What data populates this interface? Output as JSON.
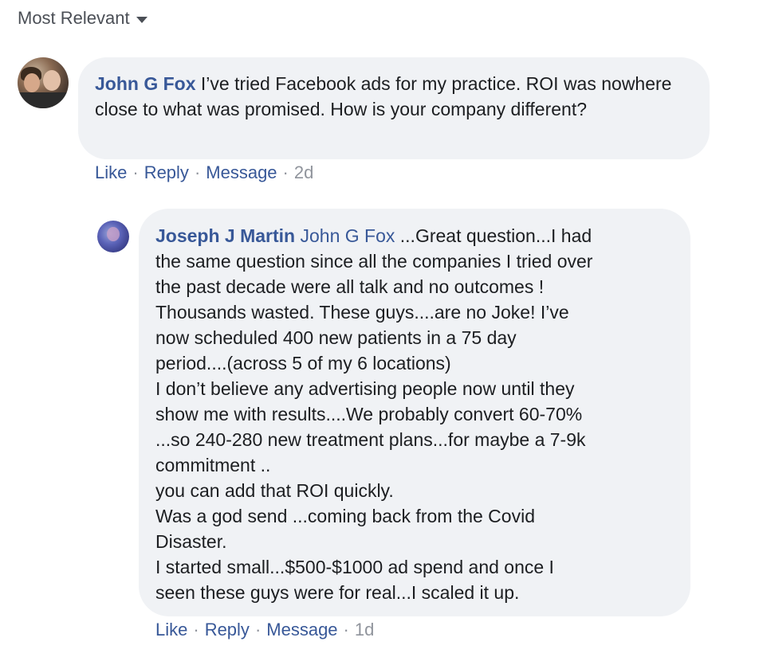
{
  "sort": {
    "label": "Most Relevant"
  },
  "comments": [
    {
      "author": "John G Fox",
      "text": "I’ve tried Facebook ads for my practice. ROI was nowhere close to what was promised. How is your company different?",
      "actions": {
        "like": "Like",
        "reply": "Reply",
        "message": "Message",
        "time": "2d"
      }
    }
  ],
  "replies": [
    {
      "author": "Joseph J Martin",
      "mention": "John G Fox",
      "lines": [
        "...Great question...I had",
        "the same question since all the companies I tried over",
        "the past decade were all talk and no outcomes !",
        "Thousands wasted. These guys....are no Joke! I’ve",
        "now scheduled 400 new patients in a 75 day",
        "period....(across 5 of my 6 locations)",
        "I don’t believe any advertising people now until they",
        "show me with results....We probably convert 60-70%",
        "...so 240-280 new treatment plans...for maybe a 7-9k",
        "commitment ..",
        "you can add that ROI quickly.",
        "Was a god send ...coming back from the Covid",
        "Disaster.",
        "I started small...$500-$1000 ad spend and once I",
        "seen these guys were for real...I scaled it up."
      ],
      "actions": {
        "like": "Like",
        "reply": "Reply",
        "message": "Message",
        "time": "1d"
      }
    }
  ],
  "separator": "·",
  "colors": {
    "link": "#385898",
    "bubble": "#f0f2f5",
    "meta": "#90949c"
  }
}
